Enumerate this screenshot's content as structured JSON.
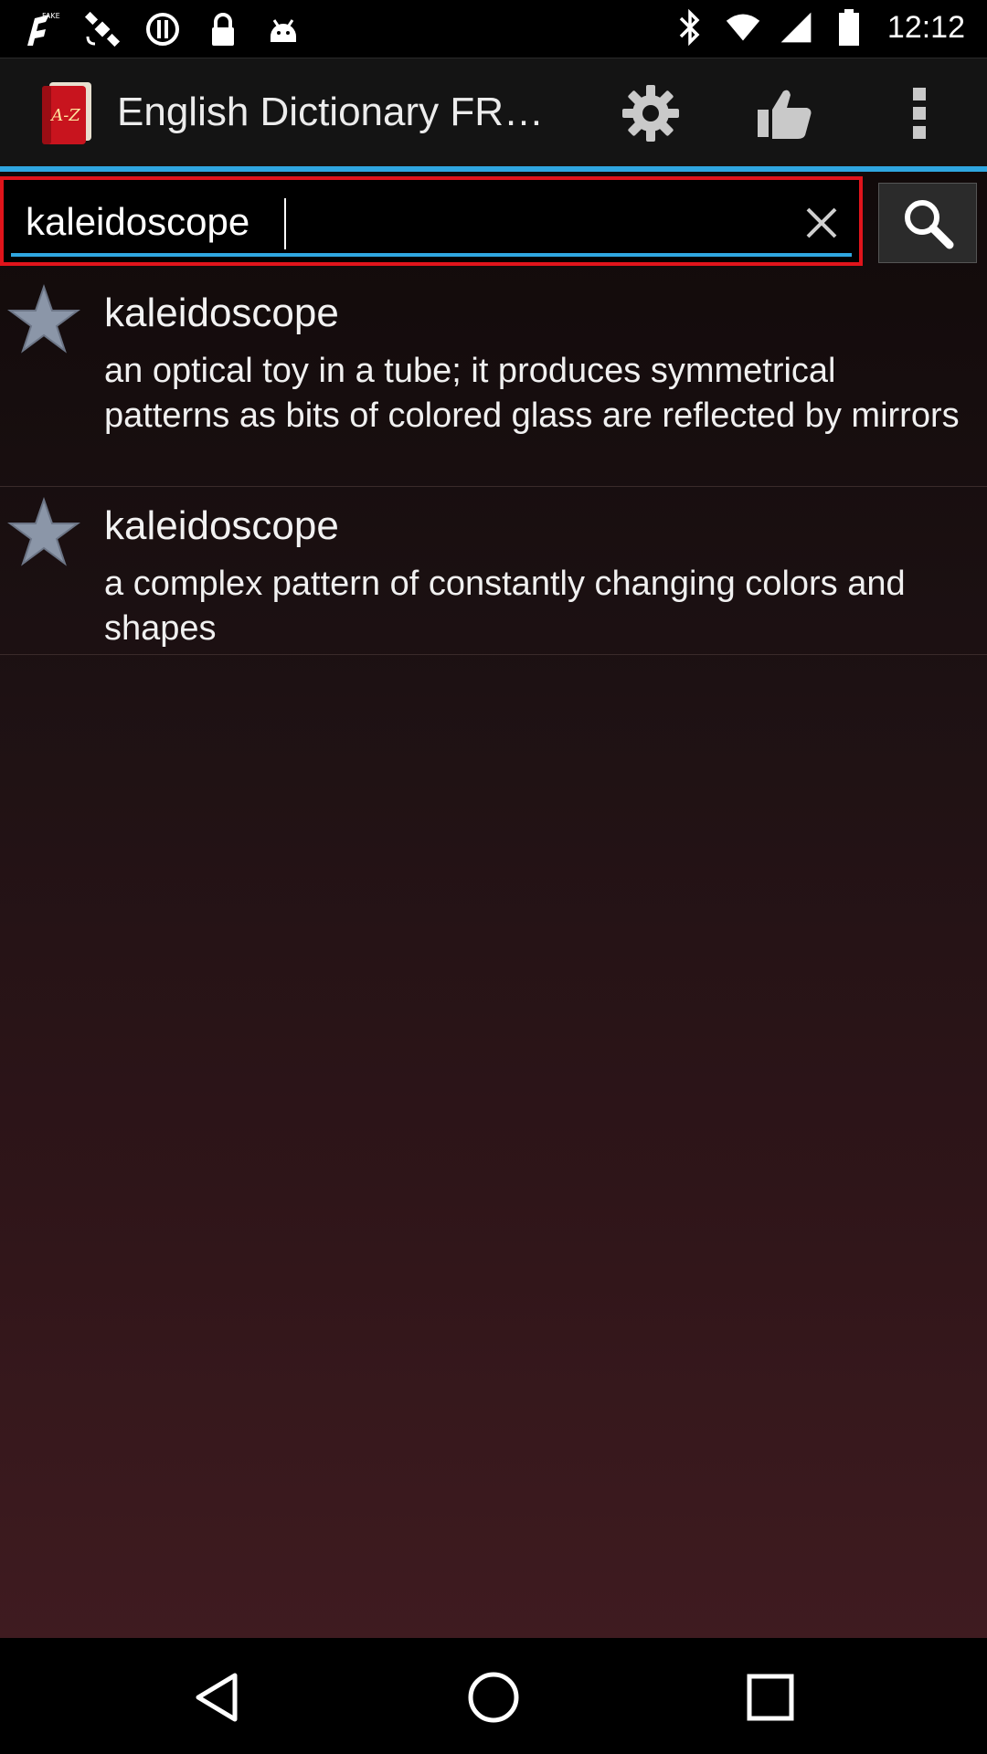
{
  "status_bar": {
    "time": "12:12",
    "left_icons": [
      "fake-gps-icon",
      "satellite-icon",
      "sync-icon",
      "lock-icon",
      "android-icon"
    ],
    "right_icons": [
      "bluetooth-icon",
      "wifi-icon",
      "signal-icon",
      "battery-icon"
    ]
  },
  "action_bar": {
    "app_icon": "dictionary-book-icon",
    "title": "English Dictionary FR…",
    "actions": [
      "gear-icon",
      "thumbs-up-icon",
      "overflow-menu-icon"
    ],
    "accent_color": "#2fa6e0"
  },
  "search": {
    "value": "kaleidoscope",
    "clear_icon": "close-icon",
    "button_icon": "search-icon",
    "highlight_color": "#e0141b"
  },
  "results": [
    {
      "word": "kaleidoscope",
      "definition": "an optical toy in a tube; it produces symmetrical patterns as bits of colored glass are reflected by mirrors",
      "icon": "star-icon"
    },
    {
      "word": "kaleidoscope",
      "definition": "a complex pattern of constantly changing colors and shapes",
      "icon": "star-icon"
    }
  ],
  "nav_bar": {
    "buttons": [
      "back-icon",
      "home-icon",
      "recents-icon"
    ]
  }
}
